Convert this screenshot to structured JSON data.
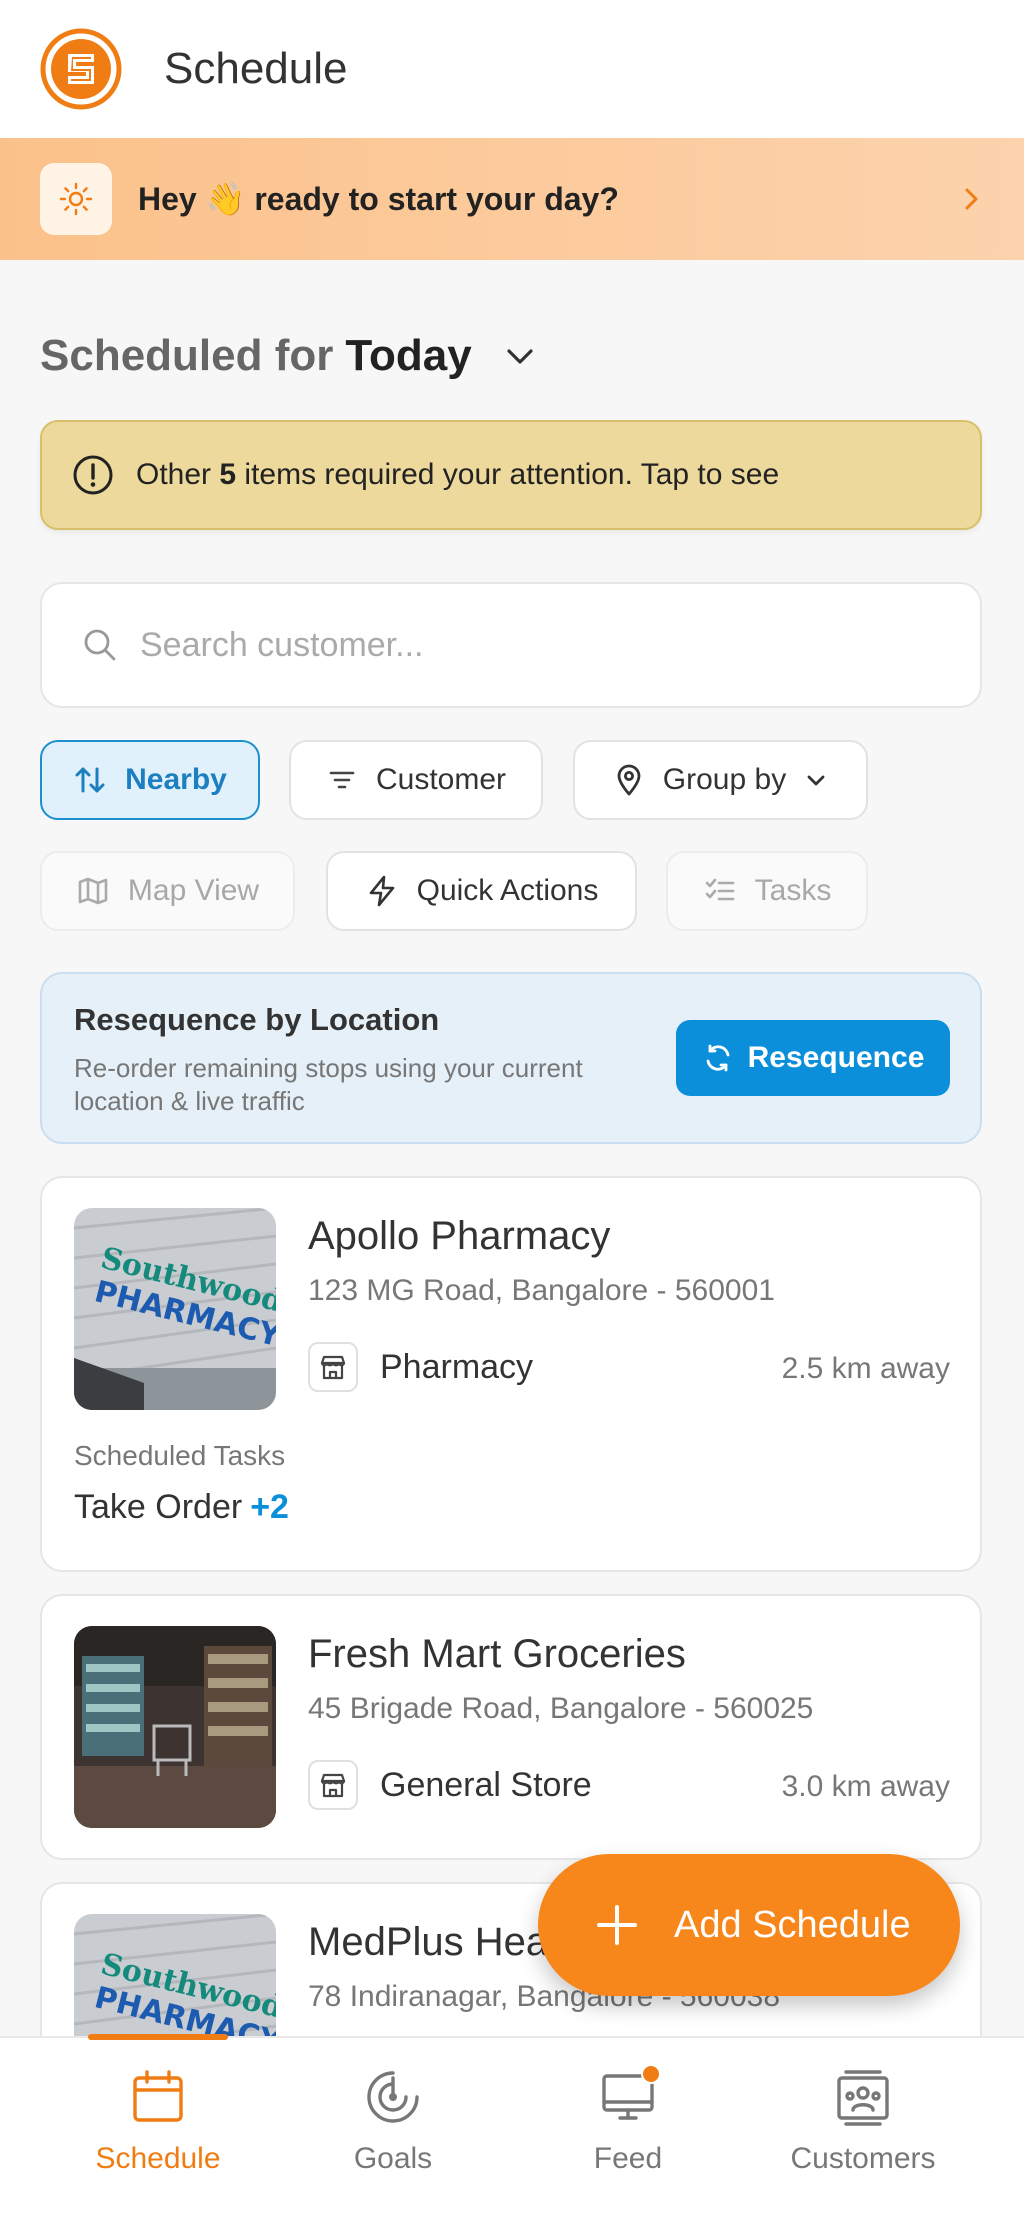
{
  "header": {
    "title": "Schedule",
    "logo_icon": "orange-s-logo"
  },
  "banner": {
    "text": "Hey 👋 ready to start your day?",
    "icon": "sun-icon"
  },
  "section": {
    "prefix": "Scheduled for",
    "day": "Today"
  },
  "alert": {
    "before": "Other ",
    "count": "5",
    "after": " items required your attention. Tap to see"
  },
  "search": {
    "placeholder": "Search customer..."
  },
  "chips": {
    "nearby": "Nearby",
    "customer": "Customer",
    "group_by": "Group by",
    "map_view": "Map View",
    "quick_actions": "Quick Actions",
    "tasks": "Tasks"
  },
  "resequence": {
    "title": "Resequence by Location",
    "description": "Re-order remaining stops using your current location & live traffic",
    "button": "Resequence"
  },
  "customers": [
    {
      "name": "Apollo Pharmacy",
      "address": "123 MG Road, Bangalore - 560001",
      "type": "Pharmacy",
      "distance": "2.5 km away",
      "scheduled_label": "Scheduled Tasks",
      "task": "Take Order",
      "more": "+2"
    },
    {
      "name": "Fresh Mart Groceries",
      "address": "45 Brigade Road, Bangalore - 560025",
      "type": "General Store",
      "distance": "3.0 km away"
    },
    {
      "name": "MedPlus Health",
      "address": "78 Indiranagar, Bangalore - 560038"
    }
  ],
  "fab": {
    "label": "Add Schedule"
  },
  "nav": {
    "schedule": "Schedule",
    "goals": "Goals",
    "feed": "Feed",
    "customers": "Customers"
  },
  "colors": {
    "accent": "#f7861b",
    "primary_blue": "#0b8fdb",
    "alert_bg": "#ecd99b"
  }
}
